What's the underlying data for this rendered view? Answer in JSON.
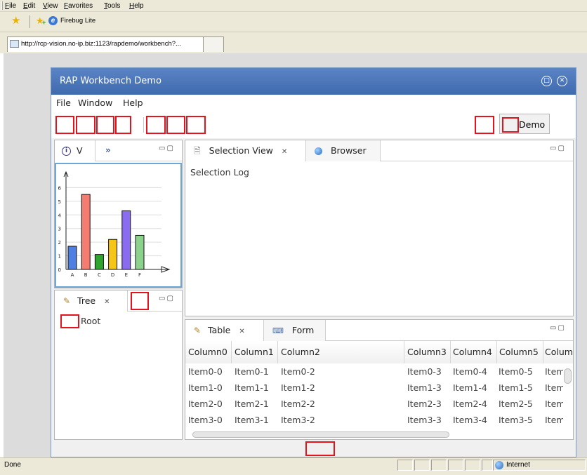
{
  "browser": {
    "menu": [
      "File",
      "Edit",
      "View",
      "Favorites",
      "Tools",
      "Help"
    ],
    "toolbar": {
      "firebug_label": "Firebug Lite"
    },
    "tab_url": "http://rcp-vision.no-ip.biz:1123/rapdemo/workbench?...",
    "status": {
      "left": "Done",
      "zone": "Internet"
    }
  },
  "window": {
    "title": "RAP Workbench Demo",
    "menu": [
      "File",
      "Window",
      "Help"
    ],
    "demo_button": "Demo"
  },
  "left_top_view": {
    "tab_label": "V",
    "overflow": "»"
  },
  "chart_data": {
    "type": "bar",
    "categories": [
      "A",
      "B",
      "C",
      "D",
      "E",
      "F"
    ],
    "values": [
      1.7,
      5.5,
      1.1,
      2.2,
      4.3,
      2.5
    ],
    "colors": [
      "#4f7fe0",
      "#f47c70",
      "#2fa52f",
      "#f5c518",
      "#8a6cf0",
      "#8cd28c"
    ],
    "yticks": [
      0,
      1,
      2,
      3,
      4,
      5,
      6
    ],
    "ylim": [
      0,
      7
    ],
    "grid": true,
    "title": "",
    "xlabel": "",
    "ylabel": ""
  },
  "tree_view": {
    "tab_label": "Tree",
    "root_label": "Root"
  },
  "selection_view": {
    "tab_label": "Selection View",
    "browser_tab_label": "Browser",
    "content": "Selection Log"
  },
  "table_view": {
    "tab_label": "Table",
    "form_tab_label": "Form",
    "columns": [
      "Column0",
      "Column1",
      "Column2",
      "Column3",
      "Column4",
      "Column5",
      "Colum"
    ],
    "rows": [
      [
        "Item0-0",
        "Item0-1",
        "Item0-2",
        "Item0-3",
        "Item0-4",
        "Item0-5",
        "Item"
      ],
      [
        "Item1-0",
        "Item1-1",
        "Item1-2",
        "Item1-3",
        "Item1-4",
        "Item1-5",
        "Item"
      ],
      [
        "Item2-0",
        "Item2-1",
        "Item2-2",
        "Item2-3",
        "Item2-4",
        "Item2-5",
        "Item"
      ],
      [
        "Item3-0",
        "Item3-1",
        "Item3-2",
        "Item3-3",
        "Item3-4",
        "Item3-5",
        "Item"
      ]
    ]
  },
  "colors": {
    "titlebar": "#4a76ba",
    "highlight_box": "#e3141e",
    "chart_border": "#6fa7d8"
  }
}
